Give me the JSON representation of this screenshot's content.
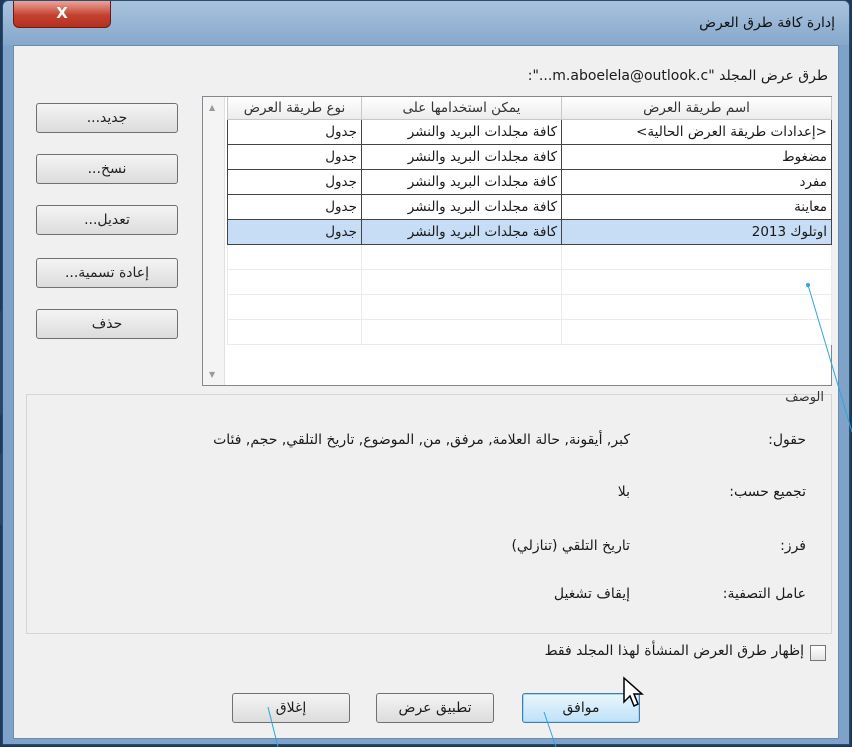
{
  "window": {
    "title": "إدارة كافة طرق العرض",
    "close_label": "X"
  },
  "folder_label": "طرق عرض المجلد \"m.aboelela@outlook.c...\":",
  "side_buttons": {
    "new": "جديد...",
    "copy": "نسخ...",
    "modify": "تعديل...",
    "rename": "إعادة تسمية...",
    "delete": "حذف"
  },
  "table": {
    "headers": [
      "اسم طريقة العرض",
      "يمكن استخدامها على",
      "نوع طريقة العرض"
    ],
    "rows": [
      [
        "<إعدادات طريقة العرض الحالية>",
        "كافة مجلدات البريد والنشر",
        "جدول"
      ],
      [
        "مضغوط",
        "كافة مجلدات البريد والنشر",
        "جدول"
      ],
      [
        "مفرد",
        "كافة مجلدات البريد والنشر",
        "جدول"
      ],
      [
        "معاينة",
        "كافة مجلدات البريد والنشر",
        "جدول"
      ],
      [
        "اوتلوك 2013",
        "كافة مجلدات البريد والنشر",
        "جدول"
      ]
    ],
    "selected_row": 4
  },
  "description": {
    "caption": "الوصف",
    "fields_label": "حقول:",
    "fields_value": "كبر, أيقونة, حالة العلامة, مرفق, من, الموضوع, تاريخ التلقي, حجم, فئات",
    "group_label": "تجميع حسب:",
    "group_value": "بلا",
    "sort_label": "فرز:",
    "sort_value": "تاريخ التلقي (تنازلي)",
    "filter_label": "عامل التصفية:",
    "filter_value": "إيقاف تشغيل"
  },
  "checkbox": {
    "label": "إظهار طرق العرض المنشأة لهذا المجلد فقط",
    "checked": false
  },
  "bottom_buttons": {
    "ok": "موافق",
    "apply": "تطبيق عرض",
    "close": "إغلاق"
  },
  "colors": {
    "title_bar": "#9bb8d8",
    "close_button": "#c4402f",
    "selection": "#c7dcf5",
    "callout_line": "#2ea6d8"
  }
}
